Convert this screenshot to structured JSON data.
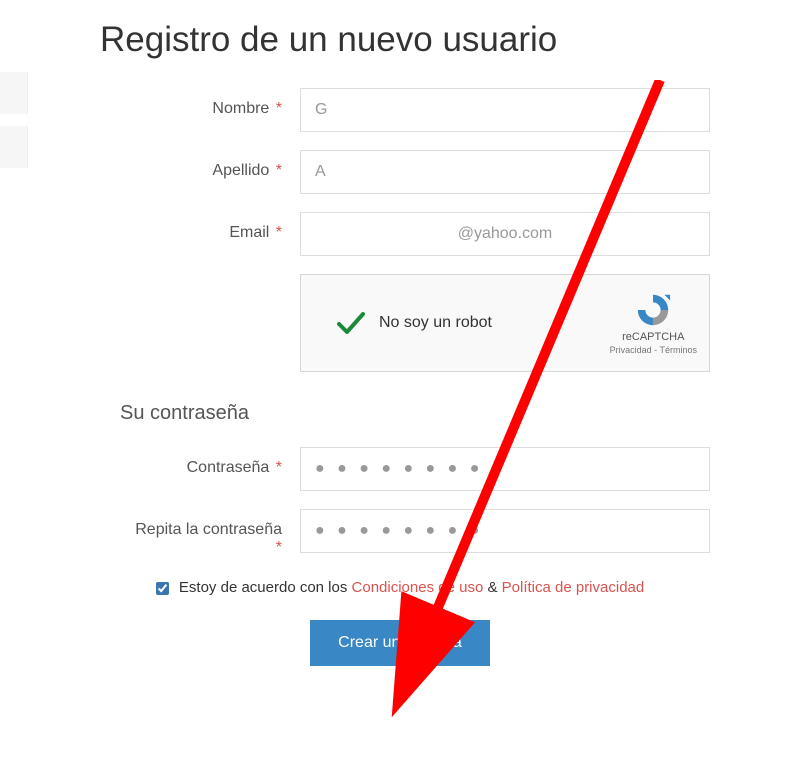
{
  "title": "Registro de un nuevo usuario",
  "fields": {
    "nombre": {
      "label": "Nombre",
      "value": "G"
    },
    "apellido": {
      "label": "Apellido",
      "value": "A"
    },
    "email": {
      "label": "Email",
      "value": "@yahoo.com"
    }
  },
  "recaptcha": {
    "text": "No soy un robot",
    "brand": "reCAPTCHA",
    "privacy": "Privacidad",
    "terms": "Términos",
    "sep": " - "
  },
  "password_section": {
    "title": "Su contraseña",
    "password_label": "Contraseña",
    "repeat_label": "Repita la contraseña",
    "dots": "● ● ● ● ● ● ● ●"
  },
  "agree": {
    "prefix": "Estoy de acuerdo con los ",
    "terms": "Condiciones de uso",
    "amp": " & ",
    "privacy": "Política de privacidad"
  },
  "submit": "Crear una cuenta"
}
